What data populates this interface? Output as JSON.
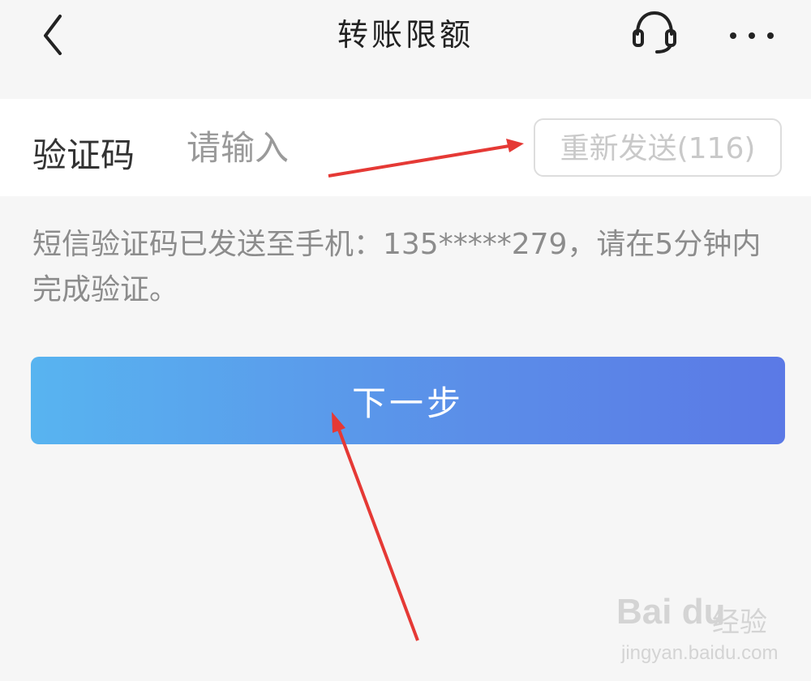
{
  "header": {
    "title": "转账限额",
    "back_icon": "chevron-left-icon",
    "support_icon": "headset-icon",
    "more_icon": "more-dots-icon"
  },
  "verification": {
    "label": "验证码",
    "placeholder": "请输入",
    "resend_label": "重新发送(116)"
  },
  "info": {
    "message": "短信验证码已发送至手机：135*****279，请在5分钟内完成验证。"
  },
  "actions": {
    "next_label": "下一步"
  },
  "watermark": {
    "logo": "Bai du",
    "brand": "经验",
    "url": "jingyan.baidu.com"
  },
  "colors": {
    "background": "#f6f6f6",
    "button_gradient_start": "#58b4f0",
    "button_gradient_end": "#5b79e6",
    "annotation_arrow": "#e53935"
  }
}
